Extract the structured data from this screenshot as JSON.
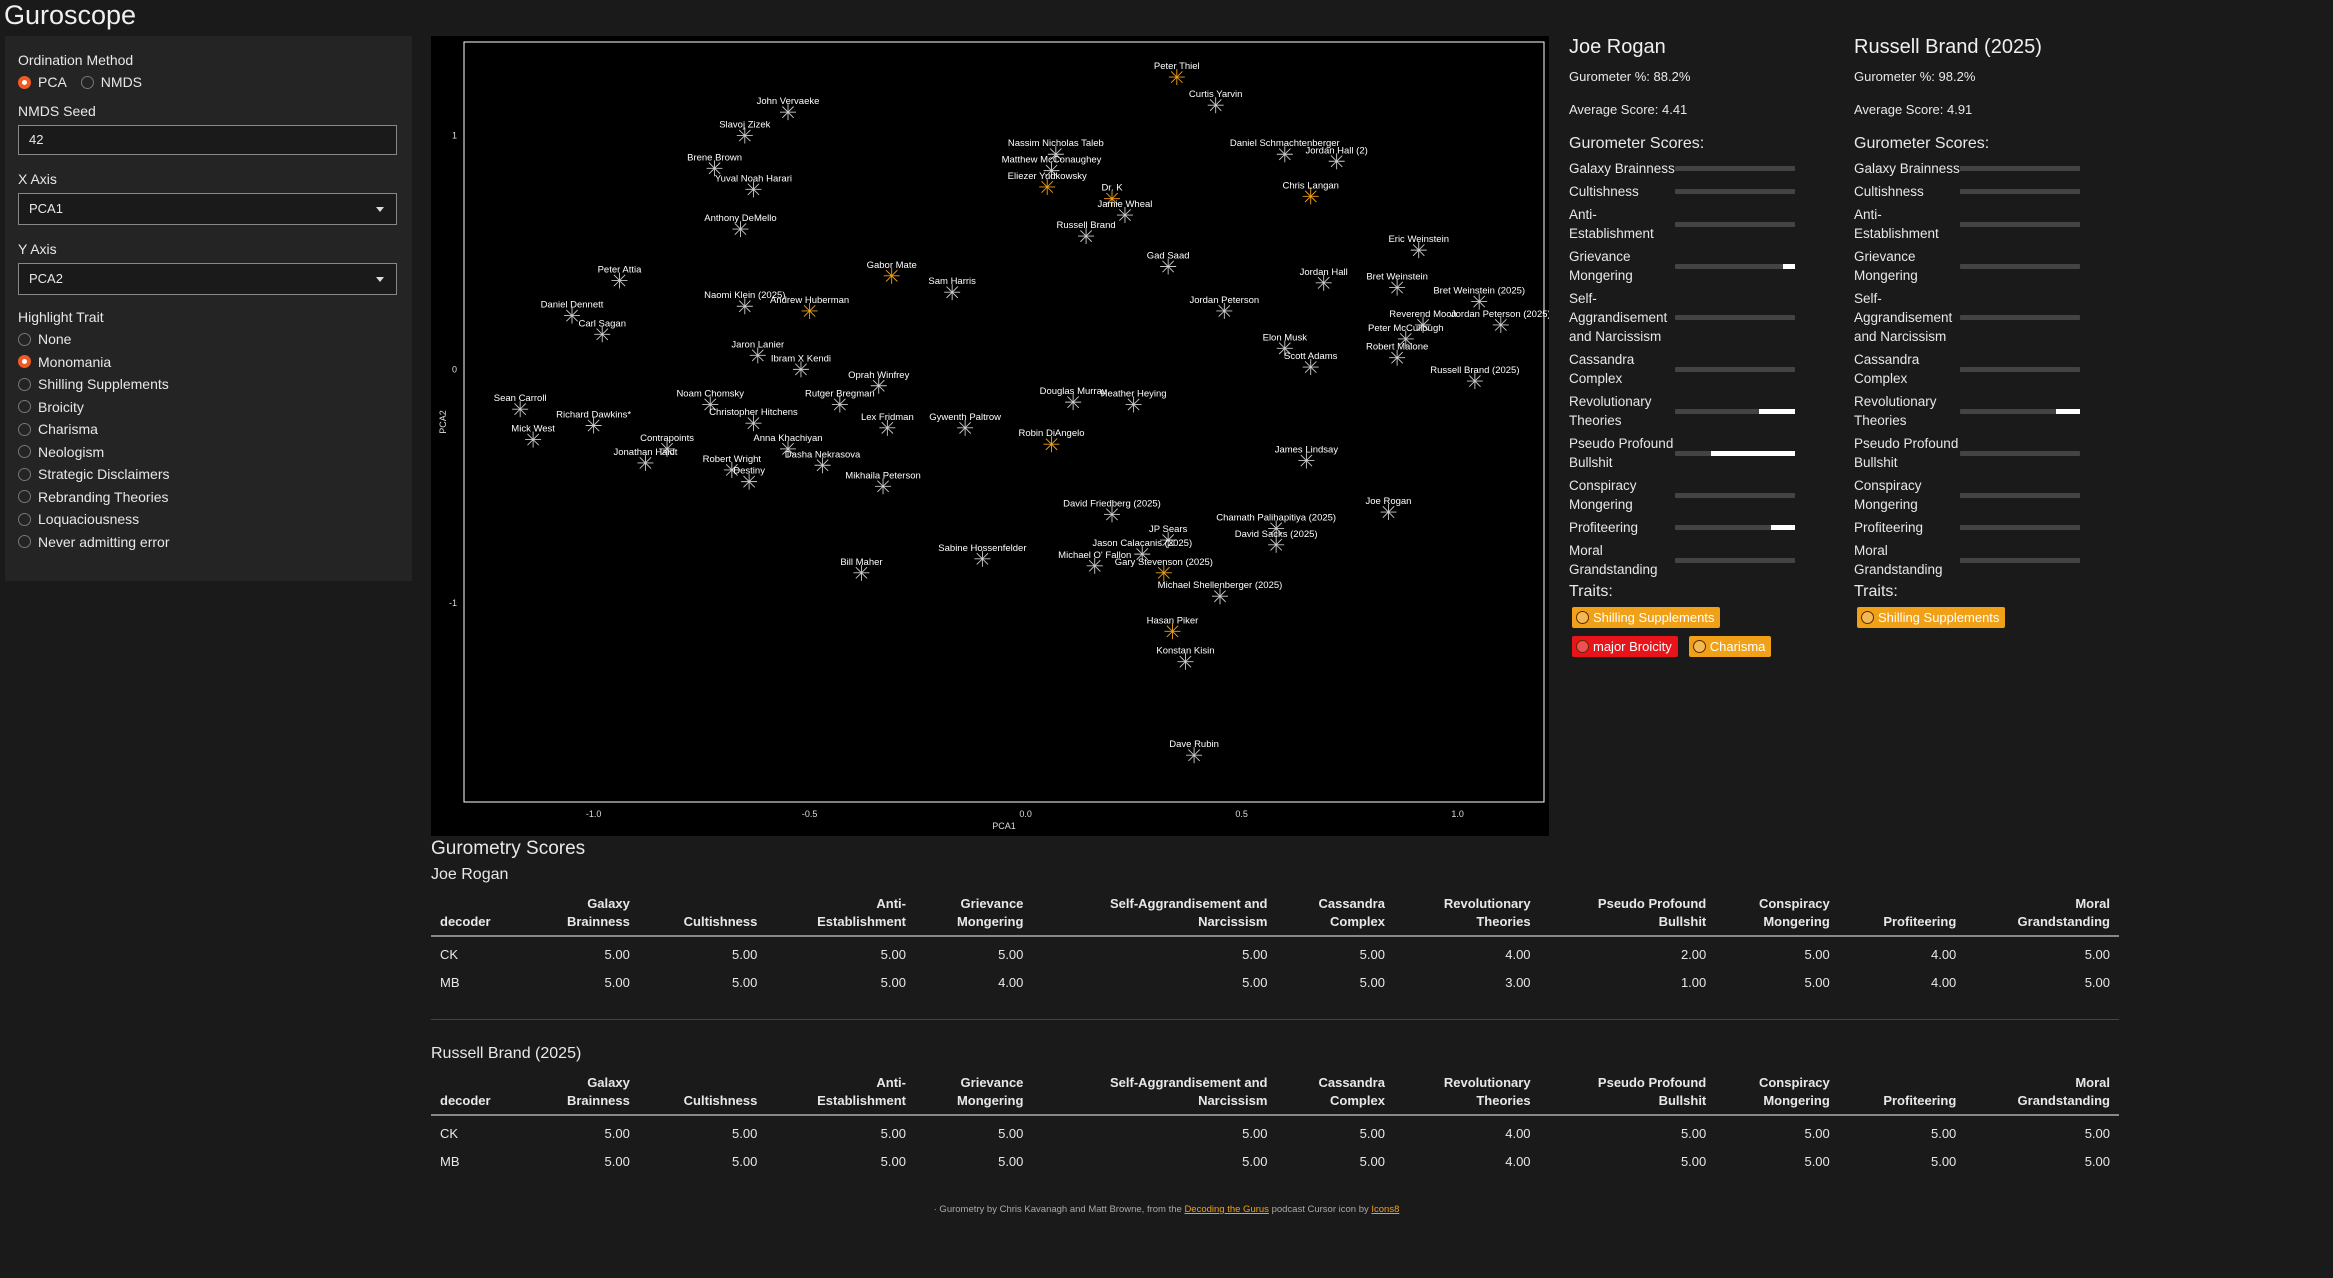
{
  "app": {
    "title": "Guroscope"
  },
  "sidebar": {
    "ordination_label": "Ordination Method",
    "ordination_options": [
      "PCA",
      "NMDS"
    ],
    "ordination_selected": "PCA",
    "seed_label": "NMDS Seed",
    "seed_value": "42",
    "x_axis_label": "X Axis",
    "x_axis_value": "PCA1",
    "y_axis_label": "Y Axis",
    "y_axis_value": "PCA2",
    "highlight_label": "Highlight Trait",
    "highlight_options": [
      "None",
      "Monomania",
      "Shilling Supplements",
      "Broicity",
      "Charisma",
      "Neologism",
      "Strategic Disclaimers",
      "Rebranding Theories",
      "Loquaciousness",
      "Never admitting error"
    ],
    "highlight_selected": "Monomania"
  },
  "colors": {
    "accent": "#f15a24",
    "highlight_point": "#f0a118",
    "normal_point": "#cccccc",
    "badge_orange": "#f0a118",
    "badge_red": "#e8141a"
  },
  "chart_data": {
    "type": "scatter",
    "xlabel": "PCA1",
    "ylabel": "PCA2",
    "xlim": [
      -1.3,
      1.2
    ],
    "ylim": [
      -1.85,
      1.4
    ],
    "xticks": [
      "-1.0",
      "-0.5",
      "0.0",
      "0.5",
      "1.0"
    ],
    "xtick_values": [
      -1.0,
      -0.5,
      0.0,
      0.5,
      1.0
    ],
    "yticks": [
      "1",
      "0",
      "-1"
    ],
    "ytick_values": [
      1,
      0,
      -1
    ],
    "points": [
      {
        "name": "Peter Thiel",
        "x": 0.35,
        "y": 1.25,
        "h": true
      },
      {
        "name": "Curtis Yarvin",
        "x": 0.44,
        "y": 1.13,
        "h": false
      },
      {
        "name": "John Vervaeke",
        "x": -0.55,
        "y": 1.1,
        "h": false
      },
      {
        "name": "Slavoj Zizek",
        "x": -0.65,
        "y": 1.0,
        "h": false
      },
      {
        "name": "Daniel Schmachtenberger",
        "x": 0.6,
        "y": 0.92,
        "h": false
      },
      {
        "name": "Jordan Hall (2)",
        "x": 0.72,
        "y": 0.89,
        "h": false
      },
      {
        "name": "Nassim Nicholas Taleb",
        "x": 0.07,
        "y": 0.92,
        "h": false
      },
      {
        "name": "Matthew McConaughey",
        "x": 0.06,
        "y": 0.85,
        "h": false
      },
      {
        "name": "Brene Brown",
        "x": -0.72,
        "y": 0.86,
        "h": false
      },
      {
        "name": "Eliezer Yudkowsky",
        "x": 0.05,
        "y": 0.78,
        "h": true
      },
      {
        "name": "Yuval Noah Harari",
        "x": -0.63,
        "y": 0.77,
        "h": false
      },
      {
        "name": "Chris Langan",
        "x": 0.66,
        "y": 0.74,
        "h": true
      },
      {
        "name": "Dr. K",
        "x": 0.2,
        "y": 0.73,
        "h": true
      },
      {
        "name": "Jamie Wheal",
        "x": 0.23,
        "y": 0.66,
        "h": false
      },
      {
        "name": "Anthony DeMello",
        "x": -0.66,
        "y": 0.6,
        "h": false
      },
      {
        "name": "Russell Brand",
        "x": 0.14,
        "y": 0.57,
        "h": false
      },
      {
        "name": "Eric Weinstein",
        "x": 0.91,
        "y": 0.51,
        "h": false
      },
      {
        "name": "Gad Saad",
        "x": 0.33,
        "y": 0.44,
        "h": false
      },
      {
        "name": "Gabor Mate",
        "x": -0.31,
        "y": 0.4,
        "h": true
      },
      {
        "name": "Jordan Hall",
        "x": 0.69,
        "y": 0.37,
        "h": false
      },
      {
        "name": "Peter Attia",
        "x": -0.94,
        "y": 0.38,
        "h": false
      },
      {
        "name": "Sam Harris",
        "x": -0.17,
        "y": 0.33,
        "h": false
      },
      {
        "name": "Bret Weinstein",
        "x": 0.86,
        "y": 0.35,
        "h": false
      },
      {
        "name": "Naomi Klein (2025)",
        "x": -0.65,
        "y": 0.27,
        "h": false
      },
      {
        "name": "Bret Weinstein (2025)",
        "x": 1.05,
        "y": 0.29,
        "h": false
      },
      {
        "name": "Daniel Dennett",
        "x": -1.05,
        "y": 0.23,
        "h": false
      },
      {
        "name": "Andrew Huberman",
        "x": -0.5,
        "y": 0.25,
        "h": true
      },
      {
        "name": "Jordan Peterson",
        "x": 0.46,
        "y": 0.25,
        "h": false
      },
      {
        "name": "Reverend Moon",
        "x": 0.92,
        "y": 0.19,
        "h": false
      },
      {
        "name": "Peter McCullough",
        "x": 0.88,
        "y": 0.13,
        "h": false
      },
      {
        "name": "Jordan Peterson (2025)",
        "x": 1.1,
        "y": 0.19,
        "h": false
      },
      {
        "name": "Carl Sagan",
        "x": -0.98,
        "y": 0.15,
        "h": false
      },
      {
        "name": "Elon Musk",
        "x": 0.6,
        "y": 0.09,
        "h": false
      },
      {
        "name": "Robert Malone",
        "x": 0.86,
        "y": 0.05,
        "h": false
      },
      {
        "name": "Jaron Lanier",
        "x": -0.62,
        "y": 0.06,
        "h": false
      },
      {
        "name": "Scott Adams",
        "x": 0.66,
        "y": 0.01,
        "h": false
      },
      {
        "name": "Ibram X Kendi",
        "x": -0.52,
        "y": 0.0,
        "h": false
      },
      {
        "name": "Oprah Winfrey",
        "x": -0.34,
        "y": -0.07,
        "h": false
      },
      {
        "name": "Russell Brand (2025)",
        "x": 1.04,
        "y": -0.05,
        "h": false
      },
      {
        "name": "Douglas Murray",
        "x": 0.11,
        "y": -0.14,
        "h": false
      },
      {
        "name": "Heather Heying",
        "x": 0.25,
        "y": -0.15,
        "h": false
      },
      {
        "name": "Noam Chomsky",
        "x": -0.73,
        "y": -0.15,
        "h": false
      },
      {
        "name": "Rutger Bregman",
        "x": -0.43,
        "y": -0.15,
        "h": false
      },
      {
        "name": "Sean Carroll",
        "x": -1.17,
        "y": -0.17,
        "h": false
      },
      {
        "name": "Christopher Hitchens",
        "x": -0.63,
        "y": -0.23,
        "h": false
      },
      {
        "name": "Richard Dawkins*",
        "x": -1.0,
        "y": -0.24,
        "h": false
      },
      {
        "name": "Lex Fridman",
        "x": -0.32,
        "y": -0.25,
        "h": false
      },
      {
        "name": "Gywenth Paltrow",
        "x": -0.14,
        "y": -0.25,
        "h": false
      },
      {
        "name": "Mick West",
        "x": -1.14,
        "y": -0.3,
        "h": false
      },
      {
        "name": "Contrapoints",
        "x": -0.83,
        "y": -0.34,
        "h": false
      },
      {
        "name": "Robin DiAngelo",
        "x": 0.06,
        "y": -0.32,
        "h": true
      },
      {
        "name": "Anna Khachiyan",
        "x": -0.55,
        "y": -0.34,
        "h": false
      },
      {
        "name": "James Lindsay",
        "x": 0.65,
        "y": -0.39,
        "h": false
      },
      {
        "name": "Jonathan Haidt",
        "x": -0.88,
        "y": -0.4,
        "h": false
      },
      {
        "name": "Dasha Nekrasova",
        "x": -0.47,
        "y": -0.41,
        "h": false
      },
      {
        "name": "Robert Wright",
        "x": -0.68,
        "y": -0.43,
        "h": false
      },
      {
        "name": "Destiny",
        "x": -0.64,
        "y": -0.48,
        "h": false
      },
      {
        "name": "Mikhaila Peterson",
        "x": -0.33,
        "y": -0.5,
        "h": false
      },
      {
        "name": "Joe Rogan",
        "x": 0.84,
        "y": -0.61,
        "h": false
      },
      {
        "name": "David Friedberg (2025)",
        "x": 0.2,
        "y": -0.62,
        "h": false
      },
      {
        "name": "Chamath Palihapitiya (2025)",
        "x": 0.58,
        "y": -0.68,
        "h": false
      },
      {
        "name": "JP Sears",
        "x": 0.33,
        "y": -0.73,
        "h": false
      },
      {
        "name": "David Sacks (2025)",
        "x": 0.58,
        "y": -0.75,
        "h": false
      },
      {
        "name": "Jason Calacanis (2025)",
        "x": 0.27,
        "y": -0.79,
        "h": false
      },
      {
        "name": "Sabine Hossenfelder",
        "x": -0.1,
        "y": -0.81,
        "h": false
      },
      {
        "name": "Michael O' Fallon",
        "x": 0.16,
        "y": -0.84,
        "h": false
      },
      {
        "name": "Gary Stevenson (2025)",
        "x": 0.32,
        "y": -0.87,
        "h": true
      },
      {
        "name": "Bill Maher",
        "x": -0.38,
        "y": -0.87,
        "h": false
      },
      {
        "name": "Michael Shellenberger (2025)",
        "x": 0.45,
        "y": -0.97,
        "h": false
      },
      {
        "name": "Hasan Piker",
        "x": 0.34,
        "y": -1.12,
        "h": true
      },
      {
        "name": "Konstan Kisin",
        "x": 0.37,
        "y": -1.25,
        "h": false
      },
      {
        "name": "Dave Rubin",
        "x": 0.39,
        "y": -1.65,
        "h": false
      }
    ]
  },
  "profiles": [
    {
      "name": "Joe Rogan",
      "gurometer": "Gurometer %: 88.2%",
      "average": "Average Score: 4.41",
      "scores_title": "Gurometer Scores:",
      "scores": [
        {
          "label": "Galaxy Brainness",
          "value": 0.0
        },
        {
          "label": "Cultishness",
          "value": 0.0
        },
        {
          "label": "Anti-Establishment",
          "value": 0.0
        },
        {
          "label": "Grievance Mongering",
          "value": 0.1
        },
        {
          "label": "Self-Aggrandisement and Narcissism",
          "value": 0.0
        },
        {
          "label": "Cassandra Complex",
          "value": 0.0
        },
        {
          "label": "Revolutionary Theories",
          "value": 0.3
        },
        {
          "label": "Pseudo Profound Bullshit",
          "value": 0.7
        },
        {
          "label": "Conspiracy Mongering",
          "value": 0.0
        },
        {
          "label": "Profiteering",
          "value": 0.2
        },
        {
          "label": "Moral Grandstanding",
          "value": 0.0
        }
      ],
      "traits_title": "Traits:",
      "traits": [
        {
          "label": "Shilling Supplements",
          "color": "orange"
        },
        {
          "label": "major Broicity",
          "color": "red"
        },
        {
          "label": "Charisma",
          "color": "orange"
        }
      ]
    },
    {
      "name": "Russell Brand (2025)",
      "gurometer": "Gurometer %: 98.2%",
      "average": "Average Score: 4.91",
      "scores_title": "Gurometer Scores:",
      "scores": [
        {
          "label": "Galaxy Brainness",
          "value": 0.0
        },
        {
          "label": "Cultishness",
          "value": 0.0
        },
        {
          "label": "Anti-Establishment",
          "value": 0.0
        },
        {
          "label": "Grievance Mongering",
          "value": 0.0
        },
        {
          "label": "Self-Aggrandisement and Narcissism",
          "value": 0.0
        },
        {
          "label": "Cassandra Complex",
          "value": 0.0
        },
        {
          "label": "Revolutionary Theories",
          "value": 0.2
        },
        {
          "label": "Pseudo Profound Bullshit",
          "value": 0.0
        },
        {
          "label": "Conspiracy Mongering",
          "value": 0.0
        },
        {
          "label": "Profiteering",
          "value": 0.0
        },
        {
          "label": "Moral Grandstanding",
          "value": 0.0
        }
      ],
      "traits_title": "Traits:",
      "traits": [
        {
          "label": "Shilling Supplements",
          "color": "orange"
        }
      ]
    }
  ],
  "scores_section": {
    "title": "Gurometry Scores",
    "columns": [
      [
        "decoder"
      ],
      [
        "Galaxy",
        "Brainness"
      ],
      [
        "Cultishness"
      ],
      [
        "Anti-",
        "Establishment"
      ],
      [
        "Grievance",
        "Mongering"
      ],
      [
        "Self-Aggrandisement and",
        "Narcissism"
      ],
      [
        "Cassandra",
        "Complex"
      ],
      [
        "Revolutionary",
        "Theories"
      ],
      [
        "Pseudo Profound",
        "Bullshit"
      ],
      [
        "Conspiracy",
        "Mongering"
      ],
      [
        "Profiteering"
      ],
      [
        "Moral",
        "Grandstanding"
      ]
    ],
    "tables": [
      {
        "title": "Joe Rogan",
        "rows": [
          [
            "CK",
            "5.00",
            "5.00",
            "5.00",
            "5.00",
            "5.00",
            "5.00",
            "4.00",
            "2.00",
            "5.00",
            "4.00",
            "5.00"
          ],
          [
            "MB",
            "5.00",
            "5.00",
            "5.00",
            "4.00",
            "5.00",
            "5.00",
            "3.00",
            "1.00",
            "5.00",
            "4.00",
            "5.00"
          ]
        ]
      },
      {
        "title": "Russell Brand (2025)",
        "rows": [
          [
            "CK",
            "5.00",
            "5.00",
            "5.00",
            "5.00",
            "5.00",
            "5.00",
            "4.00",
            "5.00",
            "5.00",
            "5.00",
            "5.00"
          ],
          [
            "MB",
            "5.00",
            "5.00",
            "5.00",
            "5.00",
            "5.00",
            "5.00",
            "4.00",
            "5.00",
            "5.00",
            "5.00",
            "5.00"
          ]
        ]
      }
    ]
  },
  "footer": {
    "prefix": "· Gurometry by Chris Kavanagh and Matt Browne, from the ",
    "link1": "Decoding the Gurus",
    "middle": " podcast Cursor icon by ",
    "link2": "Icons8"
  }
}
